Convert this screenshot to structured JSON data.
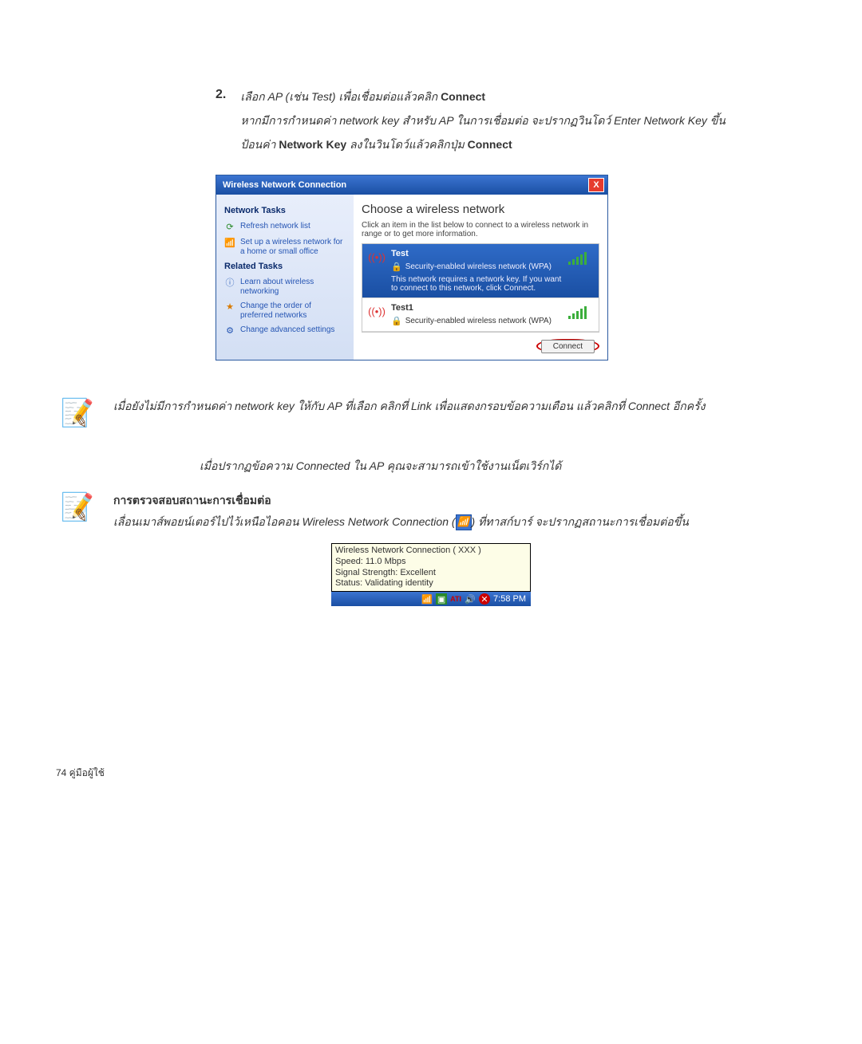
{
  "step": {
    "num": "2.",
    "line1_pre": "เลือก AP (เช่น Test) เพื่อเชื่อมต่อแล้วคลิก ",
    "line1_bold": "Connect",
    "line2_pre": "หากมีการกำหนดค่า network key สำหรับ AP ในการเชื่อมต่อ จะปรากฏวินโดว์ Enter Network Key ขึ้น",
    "line3_a": "ป้อนค่า ",
    "line3_b": "Network Key",
    "line3_c": " ลงในวินโดว์แล้วคลิกปุ่ม ",
    "line3_d": "Connect"
  },
  "win": {
    "title": "Wireless Network Connection",
    "close": "X",
    "sidebar": {
      "sec1": "Network Tasks",
      "links1": [
        "Refresh network list",
        "Set up a wireless network for a home or small office"
      ],
      "sec2": "Related Tasks",
      "links2": [
        "Learn about wireless networking",
        "Change the order of preferred networks",
        "Change advanced settings"
      ]
    },
    "main": {
      "heading": "Choose a wireless network",
      "sub": "Click an item in the list below to connect to a wireless network in range or to get more information.",
      "net1": {
        "ssid": "Test",
        "sec": "Security-enabled wireless network (WPA)",
        "hint": "This network requires a network key. If you want to connect to this network, click Connect."
      },
      "net2": {
        "ssid": "Test1",
        "sec": "Security-enabled wireless network (WPA)"
      },
      "connect": "Connect"
    }
  },
  "note1": {
    "text": "เมื่อยังไม่มีการกำหนดค่า network key ให้กับ AP ที่เลือก คลิกที่ Link เพื่อแสดงกรอบข้อความเตือน แล้วคลิกที่ Connect อีกครั้ง"
  },
  "midline": "เมื่อปรากฏข้อความ Connected ใน AP คุณจะสามารถเข้าใช้งานเน็ตเวิร์กได้",
  "note2": {
    "title": "การตรวจสอบสถานะการเชื่อมต่อ",
    "body_a": "เลื่อนเมาส์พอยน์เตอร์ไปไว้เหนือไอคอน Wireless Network Connection (",
    "body_b": ") ที่ทาสก์บาร์ จะปรากฏสถานะการเชื่อมต่อขึ้น"
  },
  "tip": {
    "l1": "Wireless Network Connection (  XXX  )",
    "l2": "Speed: 11.0 Mbps",
    "l3": "Signal Strength: Excellent",
    "l4": "Status: Validating identity",
    "time": "7:58 PM",
    "ati": "ATI"
  },
  "footer": "74  คู่มือผู้ใช้"
}
